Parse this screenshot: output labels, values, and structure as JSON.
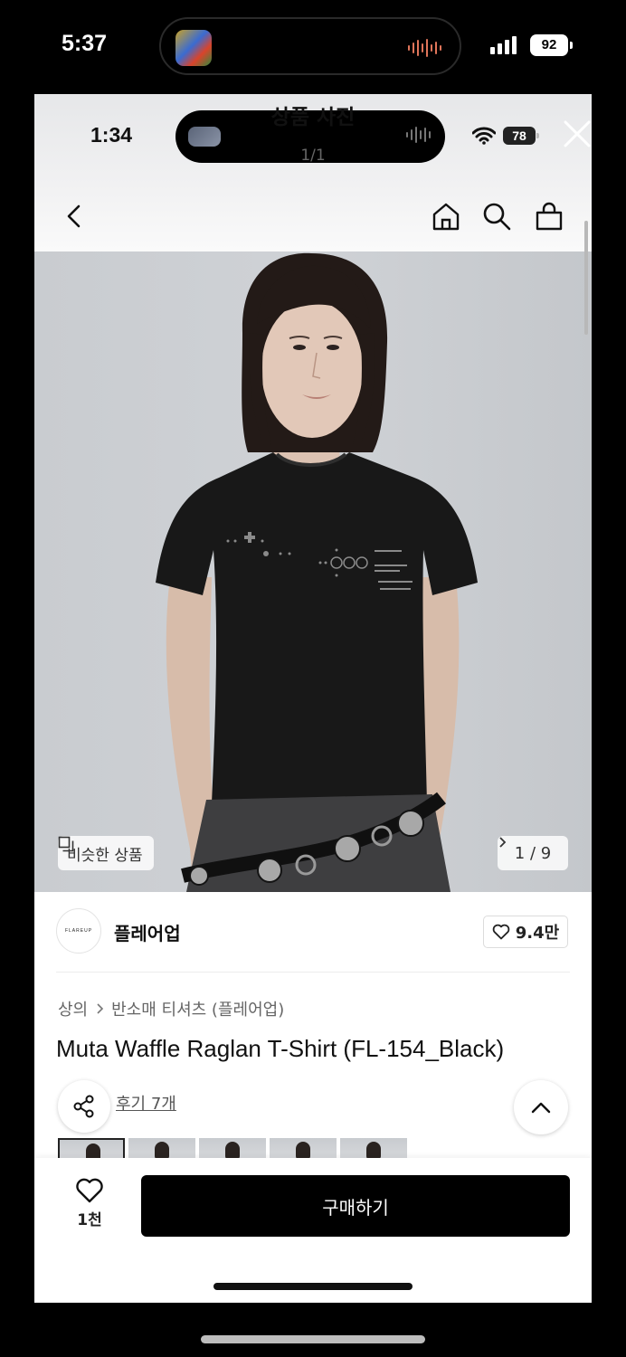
{
  "outer_status": {
    "time": "5:37",
    "battery": "92"
  },
  "inner_status": {
    "time": "1:34",
    "title": "상품 사진",
    "page_count": "1/1",
    "battery": "78"
  },
  "product": {
    "similar_label": "비슷한 상품",
    "image_counter": "1 / 9",
    "brand_logo_text": "FLAREUP",
    "brand_name": "플레어업",
    "brand_likes": "9.4만",
    "breadcrumb": [
      "상의",
      "반소매 티셔츠 (플레어업)"
    ],
    "title": "Muta Waffle Raglan T-Shirt (FL-154_Black)",
    "reviews_label": "후기 7개"
  },
  "bottom_bar": {
    "wish_count": "1천",
    "buy_label": "구매하기"
  },
  "colors": {
    "buy_button": "#000000",
    "photo_background": "#cbced2"
  },
  "icons": [
    "back-icon",
    "home-icon",
    "search-icon",
    "cart-icon",
    "close-icon",
    "wifi-icon",
    "similar-icon",
    "chevron-right-icon",
    "heart-icon",
    "share-icon",
    "chevron-up-icon"
  ]
}
